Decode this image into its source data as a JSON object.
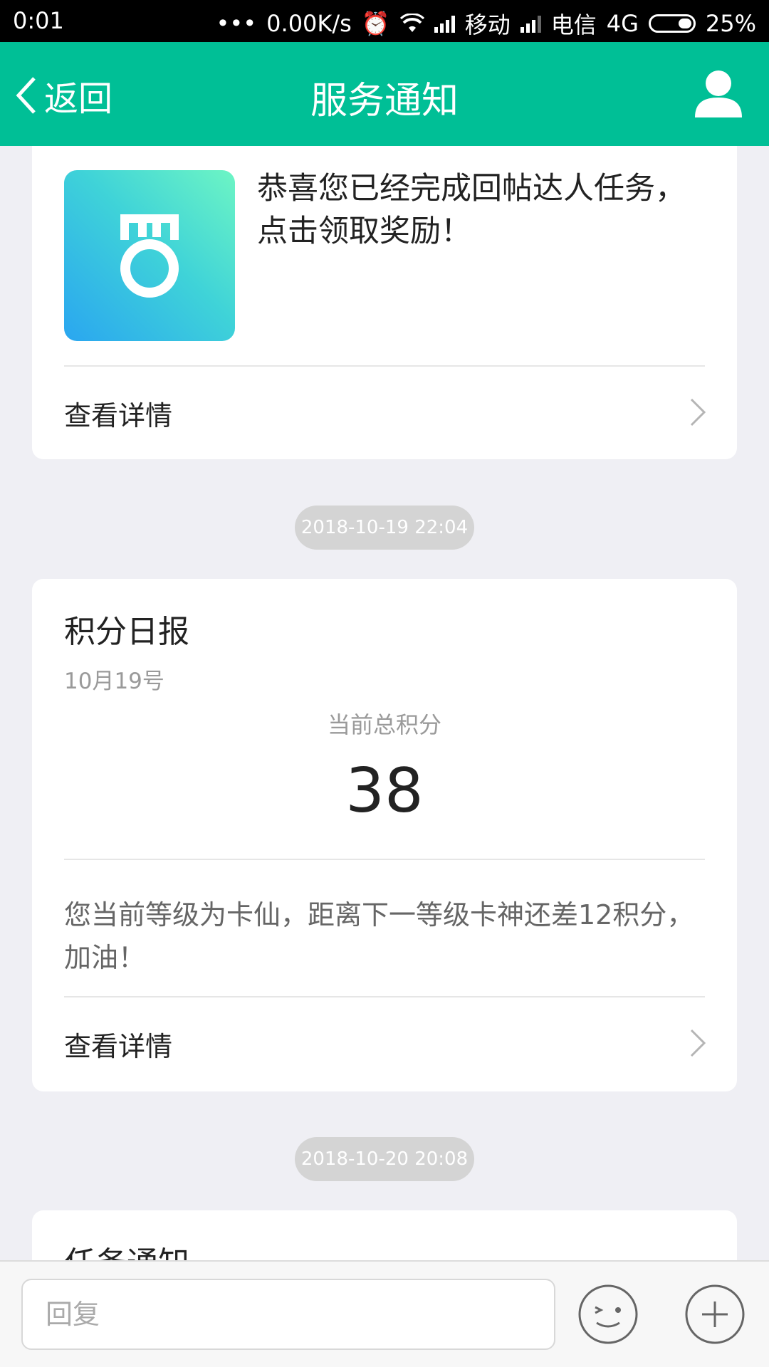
{
  "status_bar": {
    "time": "0:01",
    "dots": "•••",
    "net_speed": "0.00K/s",
    "carrier1": "移动",
    "carrier2": "电信",
    "network": "4G",
    "battery": "25%"
  },
  "header": {
    "back_label": "返回",
    "title": "服务通知",
    "background": "#00bf96"
  },
  "card1": {
    "message": "恭喜您已经完成回帖达人任务，点击领取奖励！",
    "detail_label": "查看详情"
  },
  "timestamp1": "2018-10-19 22:04",
  "card2": {
    "title": "积分日报",
    "date": "10月19号",
    "points_label": "当前总积分",
    "points_value": "38",
    "body": "您当前等级为卡仙，距离下一等级卡神还差12积分，加油！",
    "detail_label": "查看详情"
  },
  "timestamp2": "2018-10-20 20:08",
  "card3": {
    "title": "任务通知"
  },
  "bottom_bar": {
    "reply_placeholder": "回复"
  }
}
